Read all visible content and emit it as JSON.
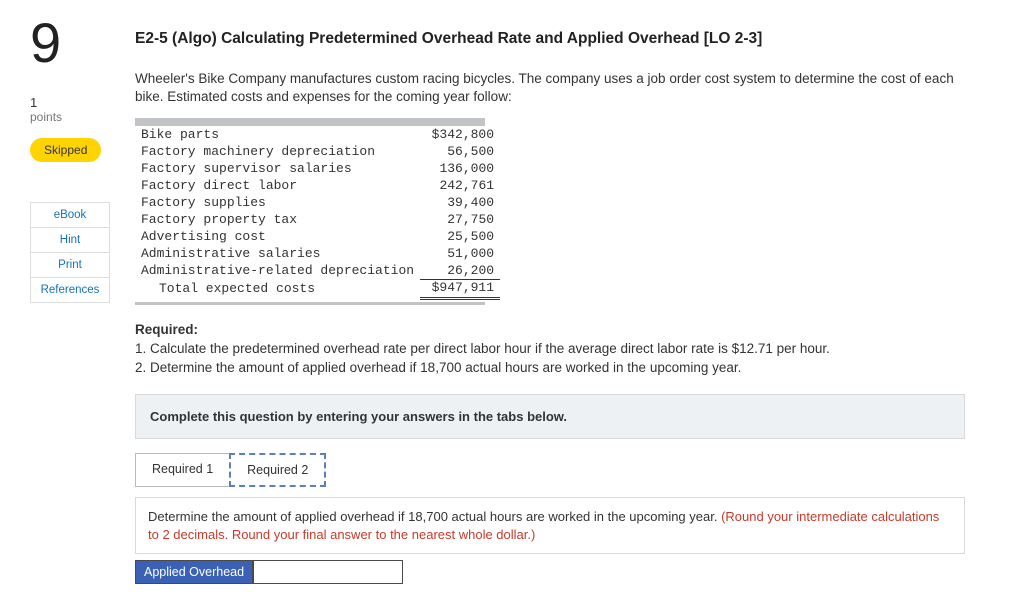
{
  "question_number": "9",
  "points_value": "1",
  "points_label": "points",
  "skipped_label": "Skipped",
  "side_links": [
    "eBook",
    "Hint",
    "Print",
    "References"
  ],
  "title": "E2-5 (Algo) Calculating Predetermined Overhead Rate and Applied Overhead [LO 2-3]",
  "intro": "Wheeler's Bike Company manufactures custom racing bicycles. The company uses a job order cost system to determine the cost of each bike. Estimated costs and expenses for the coming year follow:",
  "costs": {
    "rows": [
      {
        "label": "Bike parts",
        "amount": "$342,800"
      },
      {
        "label": "Factory machinery depreciation",
        "amount": "56,500"
      },
      {
        "label": "Factory supervisor salaries",
        "amount": "136,000"
      },
      {
        "label": "Factory direct labor",
        "amount": "242,761"
      },
      {
        "label": "Factory supplies",
        "amount": "39,400"
      },
      {
        "label": "Factory property tax",
        "amount": "27,750"
      },
      {
        "label": "Advertising cost",
        "amount": "25,500"
      },
      {
        "label": "Administrative salaries",
        "amount": "51,000"
      },
      {
        "label": "Administrative-related depreciation",
        "amount": "26,200"
      }
    ],
    "total_label": "Total expected costs",
    "total_amount": "$947,911"
  },
  "required_heading": "Required:",
  "required_1": "1. Calculate the predetermined overhead rate per direct labor hour if the average direct labor rate is $12.71 per hour.",
  "required_2": "2. Determine the amount of applied overhead if 18,700 actual hours are worked in the upcoming year.",
  "instruction": "Complete this question by entering your answers in the tabs below.",
  "tabs": {
    "req1": "Required 1",
    "req2": "Required 2"
  },
  "req2_text": "Determine the amount of applied overhead if 18,700 actual hours are worked in the upcoming year. ",
  "req2_note": "(Round your intermediate calculations to 2 decimals. Round your final answer to the nearest whole dollar.)",
  "answer_label": "Applied Overhead",
  "answer_value": ""
}
